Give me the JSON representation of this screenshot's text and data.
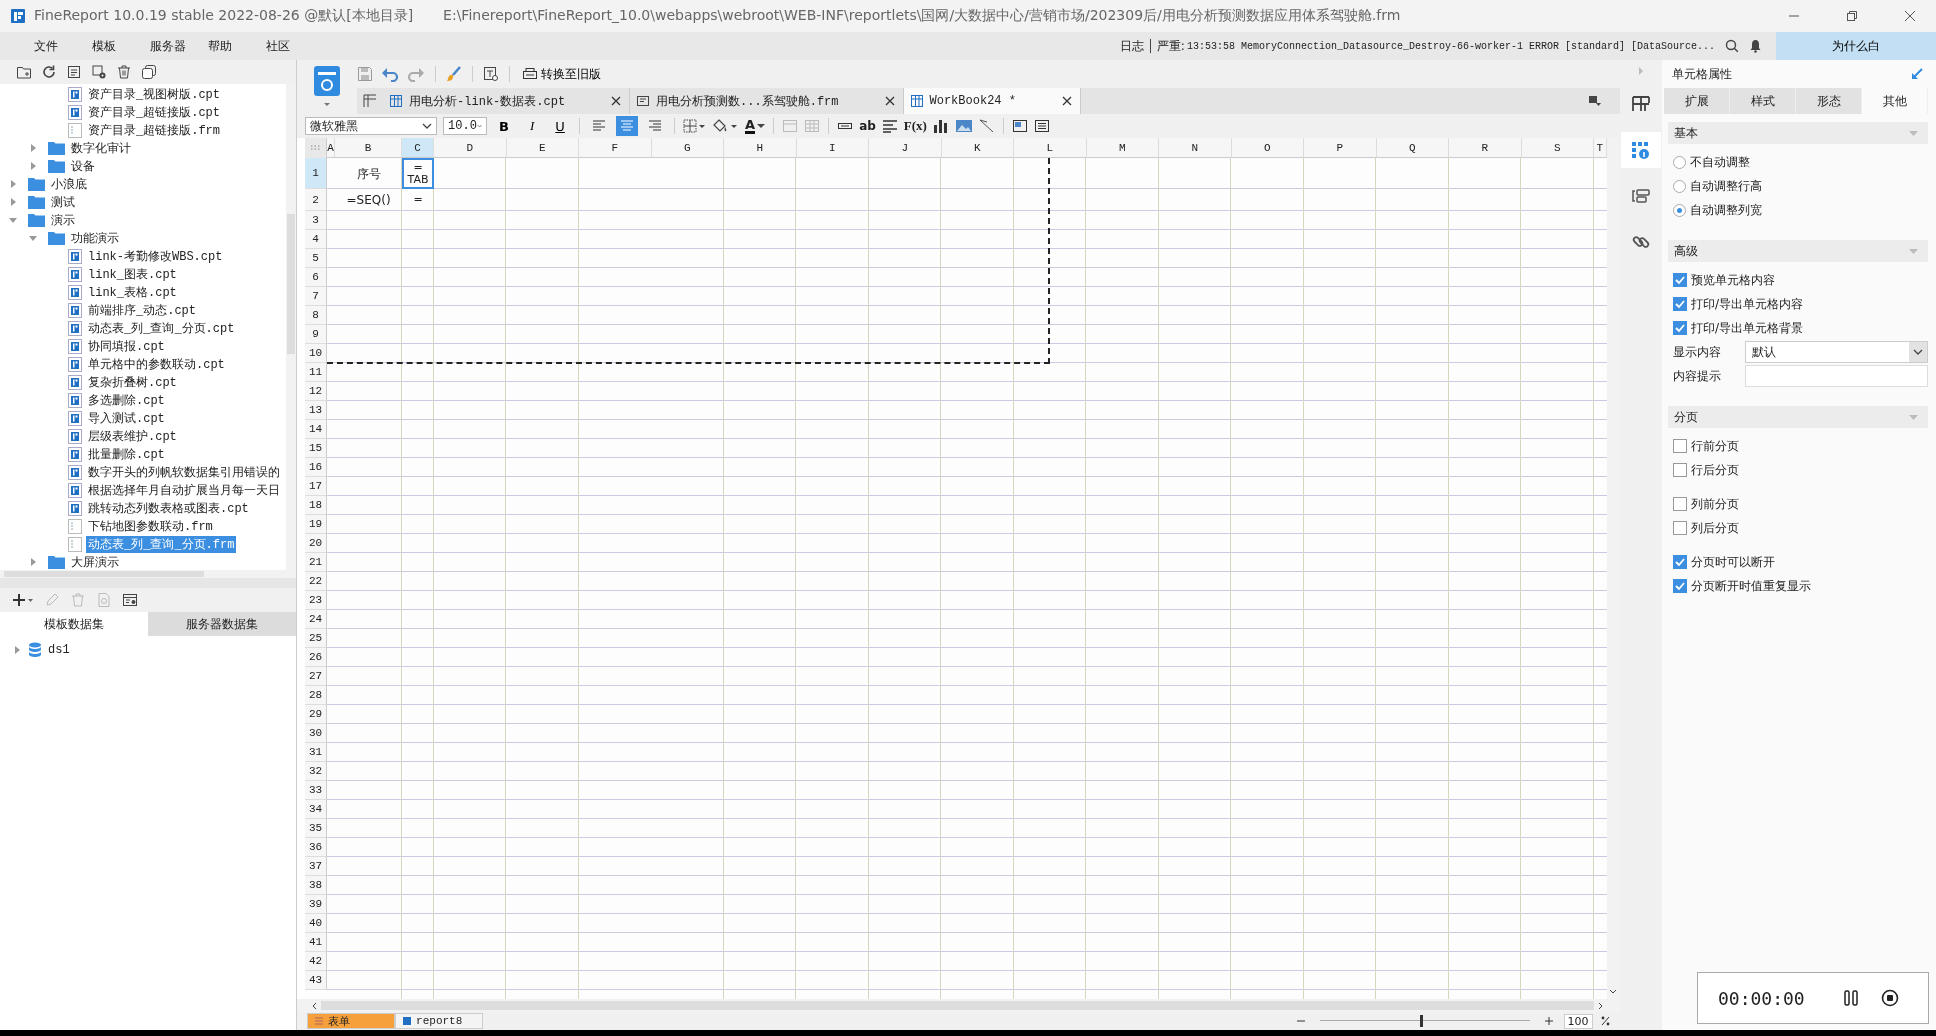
{
  "window": {
    "title": "FineReport 10.0.19 stable 2022-08-26 @默认[本地目录]",
    "path": "E:\\Finereport\\FineReport_10.0\\webapps\\webroot\\WEB-INF\\reportlets\\国网/大数据中心/营销市场/202309后/用电分析预测数据应用体系驾驶舱.frm"
  },
  "menu": [
    "文件",
    "模板",
    "服务器",
    "帮助",
    "社区"
  ],
  "log": {
    "label": "日志",
    "severity": "严重:",
    "message": "13:53:58 MemoryConnection_Datasource_Destroy-66-worker-1 ERROR [standard] [DataSource..."
  },
  "user_button": "为什么白",
  "tree": [
    {
      "kind": "group",
      "children": [
        {
          "kind": "group",
          "children": [
            {
              "kind": "cpt",
              "label": "资产目录_视图树版.cpt",
              "selected": false
            },
            {
              "kind": "cpt",
              "label": "资产目录_超链接版.cpt",
              "selected": false
            },
            {
              "kind": "frm",
              "label": "资产目录_超链接版.frm",
              "selected": false
            }
          ]
        },
        {
          "kind": "folder",
          "label": "数字化审计",
          "expanded": false
        },
        {
          "kind": "folder",
          "label": "设备",
          "expanded": false
        }
      ]
    },
    {
      "kind": "folder",
      "label": "小浪底",
      "expanded": false
    },
    {
      "kind": "folder",
      "label": "测试",
      "expanded": false
    },
    {
      "kind": "folder",
      "label": "演示",
      "expanded": true,
      "children": [
        {
          "kind": "folder",
          "label": "功能演示",
          "expanded": true,
          "children": [
            {
              "kind": "cpt",
              "label": "link-考勤修改WBS.cpt",
              "selected": false
            },
            {
              "kind": "cpt",
              "label": "link_图表.cpt",
              "selected": false
            },
            {
              "kind": "cpt",
              "label": "link_表格.cpt",
              "selected": false
            },
            {
              "kind": "cpt",
              "label": "前端排序_动态.cpt",
              "selected": false
            },
            {
              "kind": "cpt",
              "label": "动态表_列_查询_分页.cpt",
              "selected": false
            },
            {
              "kind": "cpt",
              "label": "协同填报.cpt",
              "selected": false
            },
            {
              "kind": "cpt",
              "label": "单元格中的参数联动.cpt",
              "selected": false
            },
            {
              "kind": "cpt",
              "label": "复杂折叠树.cpt",
              "selected": false
            },
            {
              "kind": "cpt",
              "label": "多选删除.cpt",
              "selected": false
            },
            {
              "kind": "cpt",
              "label": "导入测试.cpt",
              "selected": false
            },
            {
              "kind": "cpt",
              "label": "层级表维护.cpt",
              "selected": false
            },
            {
              "kind": "cpt",
              "label": "批量删除.cpt",
              "selected": false
            },
            {
              "kind": "cpt",
              "label": "数字开头的列帆软数据集引用错误的",
              "selected": false
            },
            {
              "kind": "cpt",
              "label": "根据选择年月自动扩展当月每一天日",
              "selected": false
            },
            {
              "kind": "cpt",
              "label": "跳转动态列数表格或图表.cpt",
              "selected": false
            },
            {
              "kind": "frm",
              "label": "下钻地图参数联动.frm",
              "selected": false
            },
            {
              "kind": "frm",
              "label": "动态表_列_查询_分页.frm",
              "selected": true
            }
          ]
        },
        {
          "kind": "folder",
          "label": "大屏演示",
          "expanded": false
        }
      ]
    }
  ],
  "datasets": {
    "tabs": [
      {
        "label": "模板数据集",
        "selected": true
      },
      {
        "label": "服务器数据集",
        "selected": false
      }
    ],
    "items": [
      {
        "label": "ds1",
        "expanded": false
      }
    ]
  },
  "toolbar": {
    "convert_button": "转换至旧版"
  },
  "doc_tabs": [
    {
      "label": "用电分析-link-数据表.cpt",
      "kind": "cpt",
      "selected": false
    },
    {
      "label": "用电分析预测数...系驾驶舱.frm",
      "kind": "frm",
      "selected": false
    },
    {
      "label": "WorkBook24 *",
      "kind": "cpt",
      "selected": true
    }
  ],
  "format": {
    "font": "微软雅黑",
    "size": "10.0",
    "styles": [
      "B",
      "I",
      "U"
    ],
    "align": [
      {
        "selected": false
      },
      {
        "selected": true
      },
      {
        "selected": false
      }
    ],
    "font_color_label": "A",
    "text_label": "ab",
    "formula_label": "F(x)"
  },
  "sheet": {
    "columns": [
      {
        "label": "A",
        "selected": false
      },
      {
        "label": "B",
        "selected": false
      },
      {
        "label": "C",
        "selected": true
      },
      {
        "label": "D",
        "selected": false
      },
      {
        "label": "E",
        "selected": false
      },
      {
        "label": "F",
        "selected": false
      },
      {
        "label": "G",
        "selected": false
      },
      {
        "label": "H",
        "selected": false
      },
      {
        "label": "I",
        "selected": false
      },
      {
        "label": "J",
        "selected": false
      },
      {
        "label": "K",
        "selected": false
      },
      {
        "label": "L",
        "selected": false
      },
      {
        "label": "M",
        "selected": false
      },
      {
        "label": "N",
        "selected": false
      },
      {
        "label": "O",
        "selected": false
      },
      {
        "label": "P",
        "selected": false
      },
      {
        "label": "Q",
        "selected": false
      },
      {
        "label": "R",
        "selected": false
      },
      {
        "label": "S",
        "selected": false
      },
      {
        "label": "T",
        "selected": false
      }
    ],
    "rows": [
      {
        "label": "1",
        "selected": true,
        "cells": [
          {
            "text": "序号",
            "selected": false
          },
          {
            "text": "= TAB",
            "selected": true
          }
        ]
      },
      {
        "label": "2",
        "selected": false,
        "cells": [
          {
            "text": "=SEQ()",
            "selected": false
          },
          {
            "text": "=",
            "selected": false
          }
        ]
      },
      {
        "label": "3",
        "selected": false
      },
      {
        "label": "4",
        "selected": false
      },
      {
        "label": "5",
        "selected": false
      },
      {
        "label": "6",
        "selected": false
      },
      {
        "label": "7",
        "selected": false
      },
      {
        "label": "8",
        "selected": false
      },
      {
        "label": "9",
        "selected": false
      },
      {
        "label": "10",
        "selected": false
      },
      {
        "label": "11",
        "selected": false
      },
      {
        "label": "12",
        "selected": false
      },
      {
        "label": "13",
        "selected": false
      },
      {
        "label": "14",
        "selected": false
      },
      {
        "label": "15",
        "selected": false
      },
      {
        "label": "16",
        "selected": false
      },
      {
        "label": "17",
        "selected": false
      },
      {
        "label": "18",
        "selected": false
      },
      {
        "label": "19",
        "selected": false
      },
      {
        "label": "20",
        "selected": false
      },
      {
        "label": "21",
        "selected": false
      },
      {
        "label": "22",
        "selected": false
      },
      {
        "label": "23",
        "selected": false
      },
      {
        "label": "24",
        "selected": false
      },
      {
        "label": "25",
        "selected": false
      },
      {
        "label": "26",
        "selected": false
      },
      {
        "label": "27",
        "selected": false
      },
      {
        "label": "28",
        "selected": false
      },
      {
        "label": "29",
        "selected": false
      },
      {
        "label": "30",
        "selected": false
      },
      {
        "label": "31",
        "selected": false
      },
      {
        "label": "32",
        "selected": false
      },
      {
        "label": "33",
        "selected": false
      },
      {
        "label": "34",
        "selected": false
      },
      {
        "label": "35",
        "selected": false
      },
      {
        "label": "36",
        "selected": false
      },
      {
        "label": "37",
        "selected": false
      },
      {
        "label": "38",
        "selected": false
      },
      {
        "label": "39",
        "selected": false
      },
      {
        "label": "40",
        "selected": false
      },
      {
        "label": "41",
        "selected": false
      },
      {
        "label": "42",
        "selected": false
      },
      {
        "label": "43",
        "selected": false
      }
    ]
  },
  "sheet_tabs": [
    {
      "label": "表单",
      "kind": "form",
      "selected": true
    },
    {
      "label": "report8",
      "kind": "report",
      "selected": false
    }
  ],
  "zoom": {
    "level": 0.48,
    "value": "100"
  },
  "side_icons": [
    {
      "selected": false
    },
    {
      "selected": true
    },
    {
      "selected": false
    },
    {
      "selected": false
    }
  ],
  "properties": {
    "title": "单元格属性",
    "tabs": [
      {
        "label": "扩展",
        "selected": false
      },
      {
        "label": "样式",
        "selected": false
      },
      {
        "label": "形态",
        "selected": false
      },
      {
        "label": "其他",
        "selected": true
      }
    ],
    "sections": [
      {
        "title": "基本",
        "groups": [
          [
            {
              "kind": "radio",
              "label": "不自动调整",
              "selected": false
            },
            {
              "kind": "radio",
              "label": "自动调整行高",
              "selected": false
            },
            {
              "kind": "radio",
              "label": "自动调整列宽",
              "selected": true
            }
          ]
        ]
      },
      {
        "title": "高级",
        "groups": [
          [
            {
              "kind": "checkbox",
              "label": "预览单元格内容",
              "checked": true
            },
            {
              "kind": "checkbox",
              "label": "打印/导出单元格内容",
              "checked": true
            },
            {
              "kind": "checkbox",
              "label": "打印/导出单元格背景",
              "checked": true
            },
            {
              "kind": "select",
              "label": "显示内容",
              "value": "默认"
            },
            {
              "kind": "input",
              "label": "内容提示"
            }
          ]
        ]
      },
      {
        "title": "分页",
        "groups": [
          [
            {
              "kind": "checkbox",
              "label": "行前分页",
              "checked": false
            },
            {
              "kind": "checkbox",
              "label": "行后分页",
              "checked": false
            }
          ],
          [
            {
              "kind": "checkbox",
              "label": "列前分页",
              "checked": false
            },
            {
              "kind": "checkbox",
              "label": "列后分页",
              "checked": false
            }
          ],
          [
            {
              "kind": "checkbox",
              "label": "分页时可以断开",
              "checked": true
            },
            {
              "kind": "checkbox",
              "label": "分页断开时值重复显示",
              "checked": true
            }
          ]
        ]
      }
    ]
  },
  "recorder": {
    "time": "00:00:00"
  }
}
